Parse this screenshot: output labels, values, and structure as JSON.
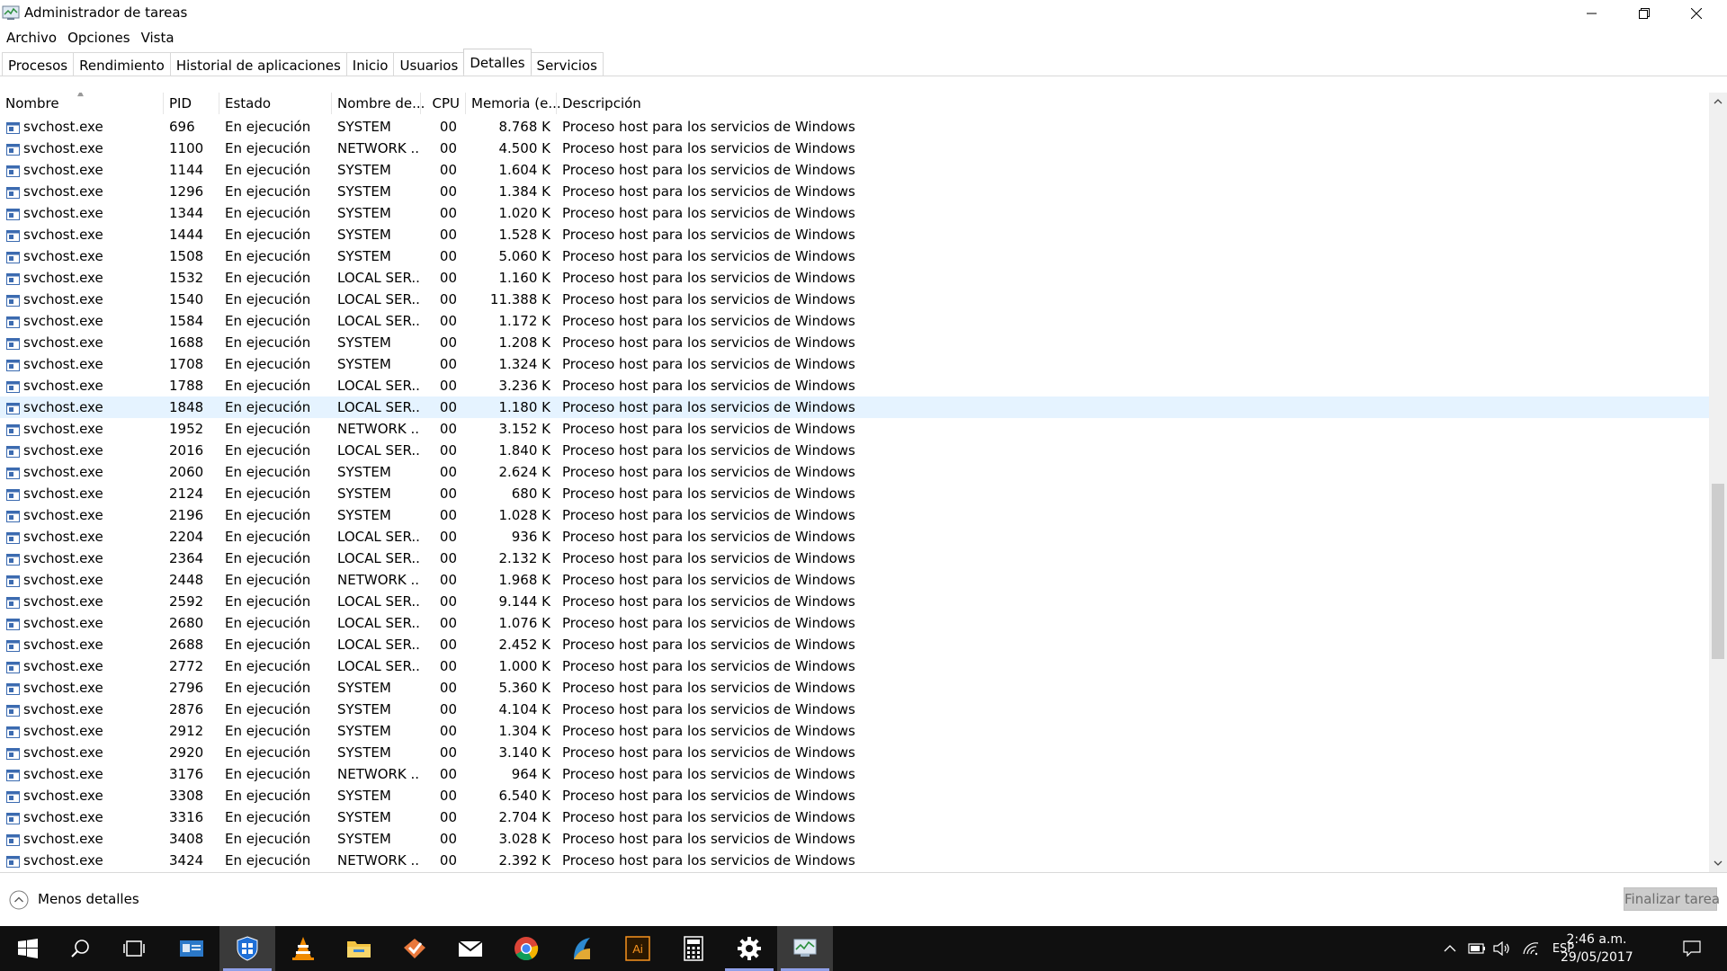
{
  "window": {
    "title": "Administrador de tareas"
  },
  "menu": [
    "Archivo",
    "Opciones",
    "Vista"
  ],
  "tabs": [
    {
      "label": "Procesos",
      "active": false
    },
    {
      "label": "Rendimiento",
      "active": false
    },
    {
      "label": "Historial de aplicaciones",
      "active": false
    },
    {
      "label": "Inicio",
      "active": false
    },
    {
      "label": "Usuarios",
      "active": false
    },
    {
      "label": "Detalles",
      "active": true
    },
    {
      "label": "Servicios",
      "active": false
    }
  ],
  "columns": {
    "name": "Nombre",
    "pid": "PID",
    "status": "Estado",
    "user": "Nombre de...",
    "cpu": "CPU",
    "memory": "Memoria (e...",
    "description": "Descripción"
  },
  "selected_pid": "1848",
  "rows": [
    {
      "name": "svchost.exe",
      "pid": "696",
      "status": "En ejecución",
      "user": "SYSTEM",
      "cpu": "00",
      "memory": "8.768 K",
      "description": "Proceso host para los servicios de Windows"
    },
    {
      "name": "svchost.exe",
      "pid": "1100",
      "status": "En ejecución",
      "user": "NETWORK ...",
      "cpu": "00",
      "memory": "4.500 K",
      "description": "Proceso host para los servicios de Windows"
    },
    {
      "name": "svchost.exe",
      "pid": "1144",
      "status": "En ejecución",
      "user": "SYSTEM",
      "cpu": "00",
      "memory": "1.604 K",
      "description": "Proceso host para los servicios de Windows"
    },
    {
      "name": "svchost.exe",
      "pid": "1296",
      "status": "En ejecución",
      "user": "SYSTEM",
      "cpu": "00",
      "memory": "1.384 K",
      "description": "Proceso host para los servicios de Windows"
    },
    {
      "name": "svchost.exe",
      "pid": "1344",
      "status": "En ejecución",
      "user": "SYSTEM",
      "cpu": "00",
      "memory": "1.020 K",
      "description": "Proceso host para los servicios de Windows"
    },
    {
      "name": "svchost.exe",
      "pid": "1444",
      "status": "En ejecución",
      "user": "SYSTEM",
      "cpu": "00",
      "memory": "1.528 K",
      "description": "Proceso host para los servicios de Windows"
    },
    {
      "name": "svchost.exe",
      "pid": "1508",
      "status": "En ejecución",
      "user": "SYSTEM",
      "cpu": "00",
      "memory": "5.060 K",
      "description": "Proceso host para los servicios de Windows"
    },
    {
      "name": "svchost.exe",
      "pid": "1532",
      "status": "En ejecución",
      "user": "LOCAL SER...",
      "cpu": "00",
      "memory": "1.160 K",
      "description": "Proceso host para los servicios de Windows"
    },
    {
      "name": "svchost.exe",
      "pid": "1540",
      "status": "En ejecución",
      "user": "LOCAL SER...",
      "cpu": "00",
      "memory": "11.388 K",
      "description": "Proceso host para los servicios de Windows"
    },
    {
      "name": "svchost.exe",
      "pid": "1584",
      "status": "En ejecución",
      "user": "LOCAL SER...",
      "cpu": "00",
      "memory": "1.172 K",
      "description": "Proceso host para los servicios de Windows"
    },
    {
      "name": "svchost.exe",
      "pid": "1688",
      "status": "En ejecución",
      "user": "SYSTEM",
      "cpu": "00",
      "memory": "1.208 K",
      "description": "Proceso host para los servicios de Windows"
    },
    {
      "name": "svchost.exe",
      "pid": "1708",
      "status": "En ejecución",
      "user": "SYSTEM",
      "cpu": "00",
      "memory": "1.324 K",
      "description": "Proceso host para los servicios de Windows"
    },
    {
      "name": "svchost.exe",
      "pid": "1788",
      "status": "En ejecución",
      "user": "LOCAL SER...",
      "cpu": "00",
      "memory": "3.236 K",
      "description": "Proceso host para los servicios de Windows"
    },
    {
      "name": "svchost.exe",
      "pid": "1848",
      "status": "En ejecución",
      "user": "LOCAL SER...",
      "cpu": "00",
      "memory": "1.180 K",
      "description": "Proceso host para los servicios de Windows"
    },
    {
      "name": "svchost.exe",
      "pid": "1952",
      "status": "En ejecución",
      "user": "NETWORK ...",
      "cpu": "00",
      "memory": "3.152 K",
      "description": "Proceso host para los servicios de Windows"
    },
    {
      "name": "svchost.exe",
      "pid": "2016",
      "status": "En ejecución",
      "user": "LOCAL SER...",
      "cpu": "00",
      "memory": "1.840 K",
      "description": "Proceso host para los servicios de Windows"
    },
    {
      "name": "svchost.exe",
      "pid": "2060",
      "status": "En ejecución",
      "user": "SYSTEM",
      "cpu": "00",
      "memory": "2.624 K",
      "description": "Proceso host para los servicios de Windows"
    },
    {
      "name": "svchost.exe",
      "pid": "2124",
      "status": "En ejecución",
      "user": "SYSTEM",
      "cpu": "00",
      "memory": "680 K",
      "description": "Proceso host para los servicios de Windows"
    },
    {
      "name": "svchost.exe",
      "pid": "2196",
      "status": "En ejecución",
      "user": "SYSTEM",
      "cpu": "00",
      "memory": "1.028 K",
      "description": "Proceso host para los servicios de Windows"
    },
    {
      "name": "svchost.exe",
      "pid": "2204",
      "status": "En ejecución",
      "user": "LOCAL SER...",
      "cpu": "00",
      "memory": "936 K",
      "description": "Proceso host para los servicios de Windows"
    },
    {
      "name": "svchost.exe",
      "pid": "2364",
      "status": "En ejecución",
      "user": "LOCAL SER...",
      "cpu": "00",
      "memory": "2.132 K",
      "description": "Proceso host para los servicios de Windows"
    },
    {
      "name": "svchost.exe",
      "pid": "2448",
      "status": "En ejecución",
      "user": "NETWORK ...",
      "cpu": "00",
      "memory": "1.968 K",
      "description": "Proceso host para los servicios de Windows"
    },
    {
      "name": "svchost.exe",
      "pid": "2592",
      "status": "En ejecución",
      "user": "LOCAL SER...",
      "cpu": "00",
      "memory": "9.144 K",
      "description": "Proceso host para los servicios de Windows"
    },
    {
      "name": "svchost.exe",
      "pid": "2680",
      "status": "En ejecución",
      "user": "LOCAL SER...",
      "cpu": "00",
      "memory": "1.076 K",
      "description": "Proceso host para los servicios de Windows"
    },
    {
      "name": "svchost.exe",
      "pid": "2688",
      "status": "En ejecución",
      "user": "LOCAL SER...",
      "cpu": "00",
      "memory": "2.452 K",
      "description": "Proceso host para los servicios de Windows"
    },
    {
      "name": "svchost.exe",
      "pid": "2772",
      "status": "En ejecución",
      "user": "LOCAL SER...",
      "cpu": "00",
      "memory": "1.000 K",
      "description": "Proceso host para los servicios de Windows"
    },
    {
      "name": "svchost.exe",
      "pid": "2796",
      "status": "En ejecución",
      "user": "SYSTEM",
      "cpu": "00",
      "memory": "5.360 K",
      "description": "Proceso host para los servicios de Windows"
    },
    {
      "name": "svchost.exe",
      "pid": "2876",
      "status": "En ejecución",
      "user": "SYSTEM",
      "cpu": "00",
      "memory": "4.104 K",
      "description": "Proceso host para los servicios de Windows"
    },
    {
      "name": "svchost.exe",
      "pid": "2912",
      "status": "En ejecución",
      "user": "SYSTEM",
      "cpu": "00",
      "memory": "1.304 K",
      "description": "Proceso host para los servicios de Windows"
    },
    {
      "name": "svchost.exe",
      "pid": "2920",
      "status": "En ejecución",
      "user": "SYSTEM",
      "cpu": "00",
      "memory": "3.140 K",
      "description": "Proceso host para los servicios de Windows"
    },
    {
      "name": "svchost.exe",
      "pid": "3176",
      "status": "En ejecución",
      "user": "NETWORK ...",
      "cpu": "00",
      "memory": "964 K",
      "description": "Proceso host para los servicios de Windows"
    },
    {
      "name": "svchost.exe",
      "pid": "3308",
      "status": "En ejecución",
      "user": "SYSTEM",
      "cpu": "00",
      "memory": "6.540 K",
      "description": "Proceso host para los servicios de Windows"
    },
    {
      "name": "svchost.exe",
      "pid": "3316",
      "status": "En ejecución",
      "user": "SYSTEM",
      "cpu": "00",
      "memory": "2.704 K",
      "description": "Proceso host para los servicios de Windows"
    },
    {
      "name": "svchost.exe",
      "pid": "3408",
      "status": "En ejecución",
      "user": "SYSTEM",
      "cpu": "00",
      "memory": "3.028 K",
      "description": "Proceso host para los servicios de Windows"
    },
    {
      "name": "svchost.exe",
      "pid": "3424",
      "status": "En ejecución",
      "user": "NETWORK ...",
      "cpu": "00",
      "memory": "2.392 K",
      "description": "Proceso host para los servicios de Windows"
    }
  ],
  "footer": {
    "less_details": "Menos detalles",
    "end_task": "Finalizar tarea"
  },
  "taskbar": {
    "apps": [
      "start-icon",
      "search-icon",
      "task-view-icon",
      "contacts-app-icon",
      "shield-app-icon",
      "vlc-icon",
      "file-explorer-icon",
      "task-app-icon",
      "mail-icon",
      "chrome-icon",
      "reader-app-icon",
      "illustrator-icon",
      "calculator-icon",
      "settings-icon",
      "task-manager-icon"
    ],
    "illustrator_label": "Ai",
    "language": "ESP",
    "time": "2:46 a.m.",
    "date": "29/05/2017"
  },
  "colors": {
    "selected_row": "#e5f3ff",
    "taskbar": "#101010",
    "running_indicator": "#8f9fe8",
    "disabled_button": "#cccccc"
  }
}
